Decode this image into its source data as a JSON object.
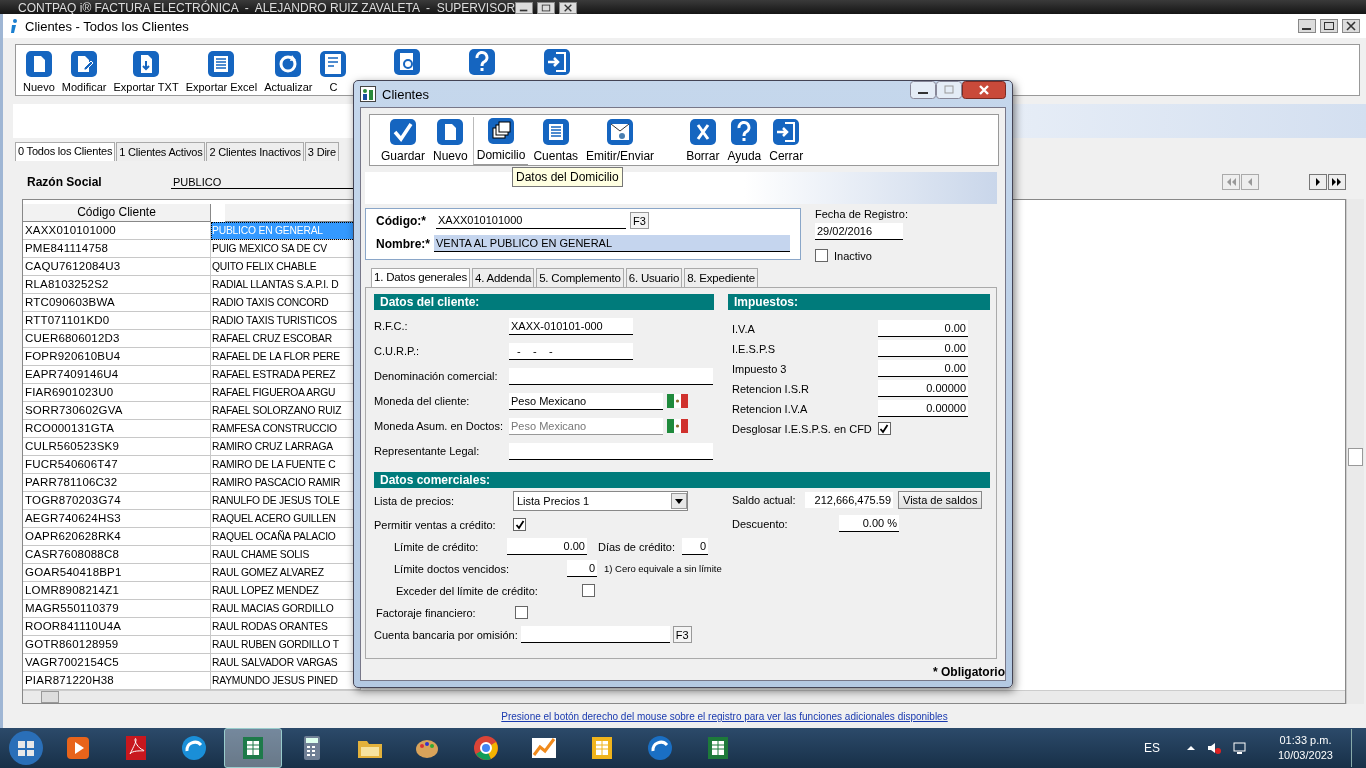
{
  "app_title": "CONTPAQ i® FACTURA ELECTRÓNICA  -  ALEJANDRO RUIZ ZAVALETA  -  SUPERVISOR",
  "window": {
    "title": "Clientes - Todos los Clientes"
  },
  "toolbar": [
    {
      "label": "Nuevo"
    },
    {
      "label": "Modificar"
    },
    {
      "label": "Exportar TXT"
    },
    {
      "label": "Exportar Excel"
    },
    {
      "label": "Actualizar"
    },
    {
      "label": "C"
    }
  ],
  "tabs": [
    {
      "label": "0 Todos los Clientes",
      "selected": true
    },
    {
      "label": "1 Clientes Activos",
      "selected": false
    },
    {
      "label": "2 Clientes Inactivos",
      "selected": false
    },
    {
      "label": "3 Dire",
      "selected": false
    }
  ],
  "filter": {
    "label": "Razón Social",
    "value": "PUBLICO"
  },
  "table": {
    "columns": [
      "Código Cliente"
    ],
    "rows": [
      {
        "code": "XAXX010101000",
        "name": "PUBLICO EN GENERAL",
        "selected": true
      },
      {
        "code": "PME841114758",
        "name": "PUIG MEXICO SA DE CV",
        "selected": false
      },
      {
        "code": "CAQU7612084U3",
        "name": "QUITO FELIX CHABLE",
        "selected": false
      },
      {
        "code": "RLA8103252S2",
        "name": "RADIAL LLANTAS S.A.P.I. D",
        "selected": false
      },
      {
        "code": "RTC090603BWA",
        "name": "RADIO TAXIS CONCORD",
        "selected": false
      },
      {
        "code": "RTT071101KD0",
        "name": "RADIO TAXIS TURISTICOS",
        "selected": false
      },
      {
        "code": "CUER6806012D3",
        "name": "RAFAEL CRUZ ESCOBAR",
        "selected": false
      },
      {
        "code": "FOPR920610BU4",
        "name": "RAFAEL DE LA FLOR PERE",
        "selected": false
      },
      {
        "code": "EAPR7409146U4",
        "name": "RAFAEL ESTRADA PEREZ",
        "selected": false
      },
      {
        "code": "FIAR6901023U0",
        "name": "RAFAEL FIGUEROA ARGU",
        "selected": false
      },
      {
        "code": "SORR730602GVA",
        "name": "RAFAEL SOLORZANO RUIZ",
        "selected": false
      },
      {
        "code": "RCO000131GTA",
        "name": "RAMFESA CONSTRUCCIO",
        "selected": false
      },
      {
        "code": "CULR560523SK9",
        "name": "RAMIRO CRUZ LARRAGA",
        "selected": false
      },
      {
        "code": "FUCR540606T47",
        "name": "RAMIRO DE LA FUENTE C",
        "selected": false
      },
      {
        "code": "PARR781106C32",
        "name": "RAMIRO PASCACIO RAMIR",
        "selected": false
      },
      {
        "code": "TOGR870203G74",
        "name": "RANULFO DE JESUS TOLE",
        "selected": false
      },
      {
        "code": "AEGR740624HS3",
        "name": "RAQUEL ACERO GUILLEN",
        "selected": false
      },
      {
        "code": "OAPR620628RK4",
        "name": "RAQUEL OCAÑA PALACIO",
        "selected": false
      },
      {
        "code": "CASR7608088C8",
        "name": "RAUL CHAME SOLIS",
        "selected": false
      },
      {
        "code": "GOAR540418BP1",
        "name": "RAUL GOMEZ ALVAREZ",
        "selected": false
      },
      {
        "code": "LOMR8908214Z1",
        "name": "RAUL LOPEZ MENDEZ",
        "selected": false
      },
      {
        "code": "MAGR550110379",
        "name": "RAUL MACIAS GORDILLO",
        "selected": false
      },
      {
        "code": "ROOR841110U4A",
        "name": "RAUL RODAS ORANTES",
        "selected": false
      },
      {
        "code": "GOTR860128959",
        "name": "RAUL RUBEN GORDILLO T",
        "selected": false
      },
      {
        "code": "VAGR7002154C5",
        "name": "RAUL SALVADOR VARGAS",
        "selected": false
      },
      {
        "code": "PIAR871220H38",
        "name": "RAYMUNDO JESUS PINED",
        "selected": false
      }
    ]
  },
  "status_text": "Presione el botón derecho del mouse sobre el registro para ver las funciones adicionales disponibles",
  "dialog": {
    "title": "Clientes",
    "toolbar": [
      {
        "label": "Guardar",
        "selected": false
      },
      {
        "label": "Nuevo",
        "selected": false
      },
      {
        "label": "Domicilio",
        "selected": true
      },
      {
        "label": "Cuentas",
        "selected": false
      },
      {
        "label": "Emitir/Enviar",
        "selected": false
      },
      {
        "label": "Borrar",
        "selected": false
      },
      {
        "label": "Ayuda",
        "selected": false
      },
      {
        "label": "Cerrar",
        "selected": false
      }
    ],
    "tooltip": "Datos del Domicilio",
    "codigo": {
      "label": "Código:*",
      "value": "XAXX010101000",
      "button": "F3"
    },
    "nombre": {
      "label": "Nombre:*",
      "value": "VENTA AL PUBLICO EN GENERAL"
    },
    "fecha": {
      "label": "Fecha de Registro:",
      "value": "29/02/2016"
    },
    "inactivo": {
      "label": "Inactivo",
      "checked": false
    },
    "tabs": [
      {
        "label": "1. Datos generales",
        "selected": true
      },
      {
        "label": "4. Addenda",
        "selected": false
      },
      {
        "label": "5. Complemento",
        "selected": false
      },
      {
        "label": "6. Usuario",
        "selected": false
      },
      {
        "label": "8. Expediente",
        "selected": false
      }
    ],
    "cliente": {
      "title": "Datos del cliente:",
      "fields": [
        {
          "label": "R.F.C.:",
          "value": "XAXX-010101-000",
          "kind": "short",
          "disabled": false
        },
        {
          "label": "C.U.R.P.:",
          "value": "  -    -    -",
          "kind": "short",
          "disabled": false
        },
        {
          "label": "Denominación comercial:",
          "kind": "long",
          "disabled": false
        },
        {
          "label": "Moneda del cliente:",
          "value": "Peso Mexicano",
          "kind": "currency",
          "disabled": false
        },
        {
          "label": "Moneda Asum. en Doctos:",
          "value": "Peso Mexicano",
          "kind": "currency",
          "disabled": true
        },
        {
          "label": "Representante Legal:",
          "kind": "long",
          "disabled": false
        }
      ]
    },
    "impuestos": {
      "title": "Impuestos:",
      "rows": [
        {
          "label": "I.V.A",
          "value": "0.00"
        },
        {
          "label": "I.E.S.P.S",
          "value": "0.00"
        },
        {
          "label": "Impuesto 3",
          "value": "0.00"
        },
        {
          "label": "Retencion I.S.R",
          "value": "0.00000"
        },
        {
          "label": "Retencion I.V.A",
          "value": "0.00000"
        }
      ],
      "desglosar": {
        "label": "Desglosar I.E.S.P.S. en CFD",
        "checked": true
      }
    },
    "comerciales": {
      "title": "Datos comerciales:",
      "lista": {
        "label": "Lista de precios:",
        "value": "Lista Precios 1"
      },
      "permitir": {
        "label": "Permitir ventas a crédito:",
        "checked": true
      },
      "limite": {
        "label": "Límite de crédito:",
        "value": "0.00"
      },
      "dias": {
        "label": "Días de crédito:",
        "value": "0"
      },
      "vencidos": {
        "label": "Límite doctos vencidos:",
        "value": "0",
        "note": "1) Cero equivale a sin límite"
      },
      "exceder": {
        "label": "Exceder del límite de crédito:",
        "checked": false
      },
      "factoraje": {
        "label": "Factoraje financiero:",
        "checked": false
      },
      "cuenta": {
        "label": "Cuenta bancaria por omisión:",
        "button": "F3"
      },
      "saldo": {
        "label": "Saldo actual:",
        "value": "212,666,475.59",
        "button": "Vista de saldos"
      },
      "descuento": {
        "label": "Descuento:",
        "value": "0.00 %"
      }
    },
    "footer": "* Obligatorio"
  },
  "taskbar": {
    "apps": [
      {
        "selected": false
      },
      {
        "selected": false
      },
      {
        "selected": false
      },
      {
        "selected": true
      },
      {
        "selected": false
      },
      {
        "selected": false
      },
      {
        "selected": false
      },
      {
        "selected": false
      },
      {
        "selected": false
      },
      {
        "selected": false
      },
      {
        "selected": false
      },
      {
        "selected": false
      }
    ],
    "language": "ES",
    "time": "01:33 p.m.",
    "date": "10/03/2023"
  }
}
